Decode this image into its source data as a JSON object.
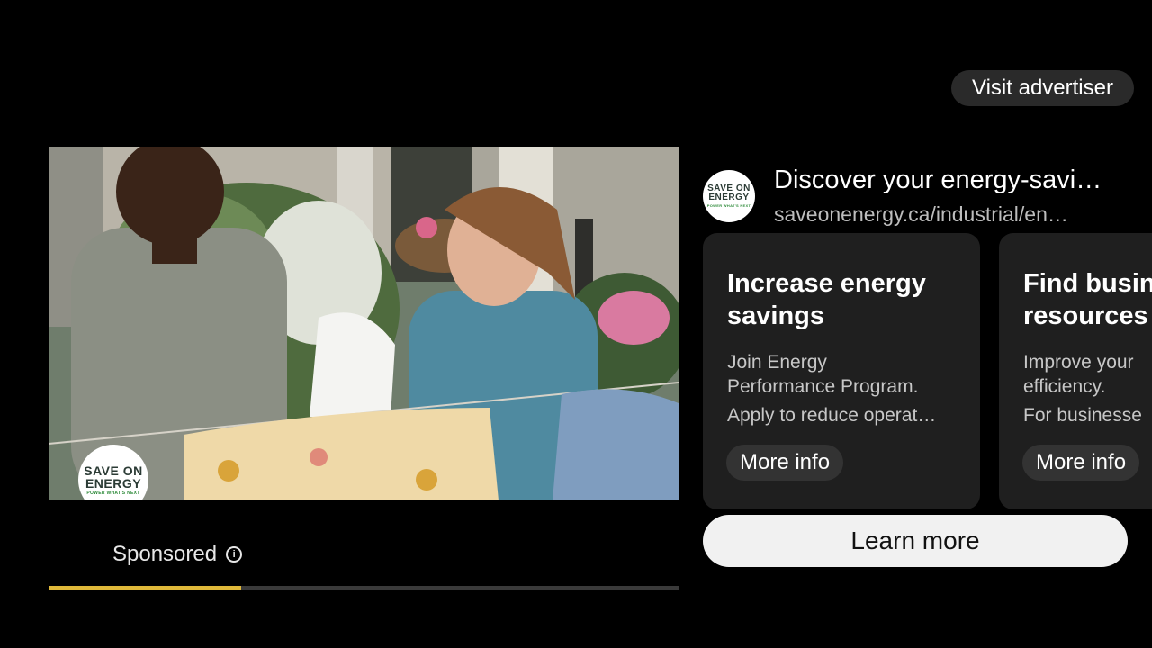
{
  "header": {
    "visit_label": "Visit advertiser"
  },
  "video": {
    "logo": {
      "line1": "SAVE ON",
      "line2": "ENERGY",
      "tagline": "POWER WHAT'S NEXT"
    },
    "sponsored_label": "Sponsored",
    "progress": 0.305,
    "progress_color": "#e0b93a"
  },
  "advertiser": {
    "logo": {
      "line1": "SAVE ON",
      "line2": "ENERGY",
      "tagline": "POWER WHAT'S NEXT"
    },
    "title": "Discover your energy-savi…",
    "url": "saveonenergy.ca/industrial/en…"
  },
  "cards": [
    {
      "title_line1": "Increase energy",
      "title_line2": "savings",
      "desc_line1": "Join Energy",
      "desc_line2": "Performance Program.",
      "desc_line3": "Apply to reduce operat…",
      "button": "More info"
    },
    {
      "title_line1": "Find busine",
      "title_line2": "resources",
      "desc_line1": "Improve your",
      "desc_line2": "efficiency.",
      "desc_line3": "For businesse",
      "button": "More info"
    }
  ],
  "cta": {
    "learn_more": "Learn more"
  },
  "icons": {
    "info": "info-icon"
  }
}
